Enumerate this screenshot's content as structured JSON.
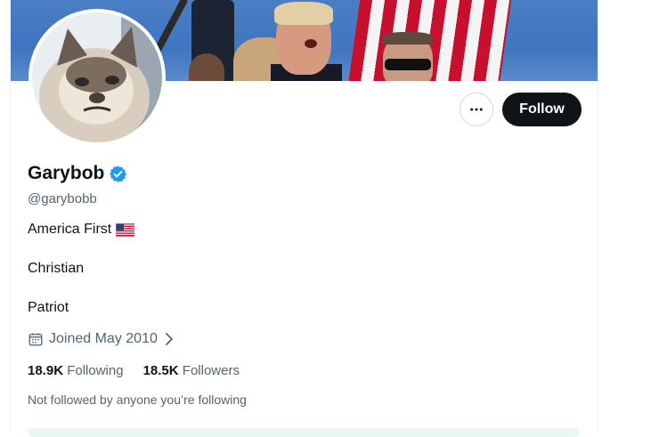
{
  "profile": {
    "name": "Garybob",
    "handle": "@garybobb",
    "verified": true,
    "bio_lines": [
      "America First",
      "Christian",
      "Patriot"
    ],
    "joined": "Joined May 2010",
    "following_count": "18.9K",
    "following_label": "Following",
    "followers_count": "18.5K",
    "followers_label": "Followers",
    "social_context": "Not followed by anyone you’re following"
  },
  "actions": {
    "follow_label": "Follow",
    "more_icon": "more-horizontal-icon"
  },
  "colors": {
    "verified_badge": "#1d9bf0",
    "follow_button_bg": "#0f1419",
    "secondary_text": "#536471"
  }
}
